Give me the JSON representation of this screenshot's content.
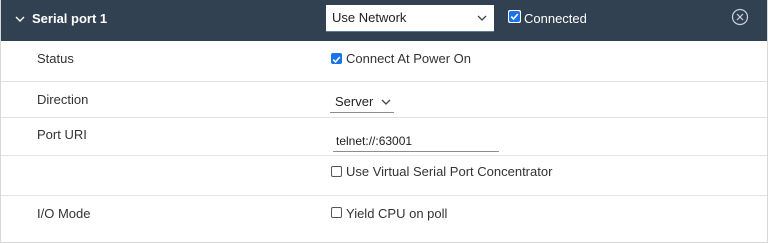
{
  "header": {
    "title": "Serial port 1",
    "connection_type": "Use Network",
    "connected_label": "Connected",
    "connected_checked": true
  },
  "rows": {
    "status": {
      "label": "Status",
      "checkbox_label": "Connect At Power On",
      "checked": true
    },
    "direction": {
      "label": "Direction",
      "value": "Server"
    },
    "port_uri": {
      "label": "Port URI",
      "value": "telnet://:63001"
    },
    "vspc": {
      "checkbox_label": "Use Virtual Serial Port Concentrator",
      "checked": false
    },
    "io_mode": {
      "label": "I/O Mode",
      "checkbox_label": "Yield CPU on poll",
      "checked": false
    }
  },
  "icons": {
    "collapse": "chevron-down-icon",
    "dropdown": "caret-down-icon",
    "remove": "close-circle-icon"
  },
  "colors": {
    "header_bg": "#324151",
    "accent": "#1a73e8",
    "row_border": "#e2e2e2"
  }
}
